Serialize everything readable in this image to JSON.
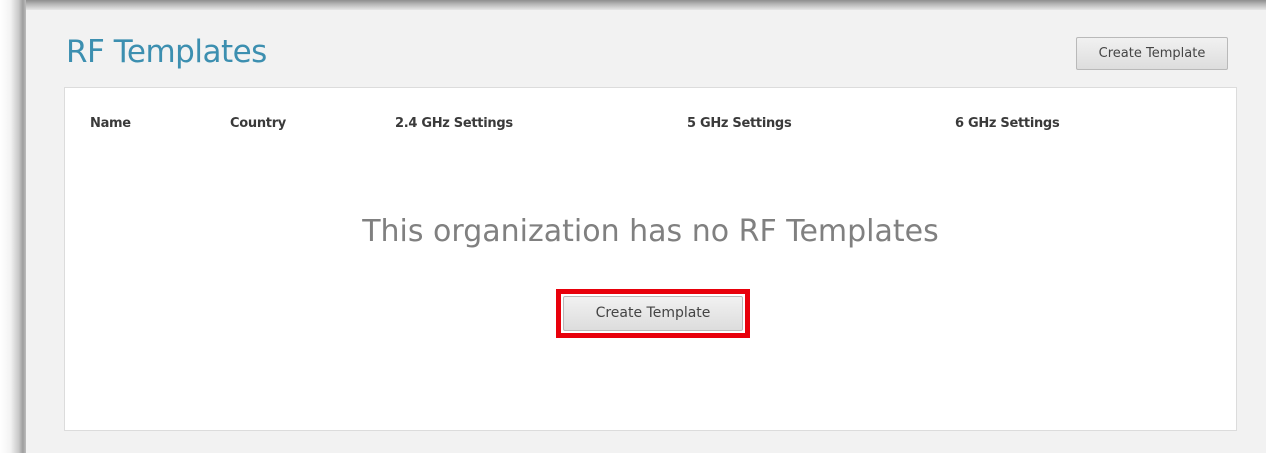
{
  "page": {
    "title": "RF Templates"
  },
  "toolbar": {
    "create_label": "Create Template"
  },
  "table": {
    "columns": [
      "Name",
      "Country",
      "2.4 GHz Settings",
      "5 GHz Settings",
      "6 GHz Settings"
    ]
  },
  "empty_state": {
    "message": "This organization has no RF Templates",
    "create_label": "Create Template",
    "highlight_color": "#e8000b"
  },
  "colors": {
    "title": "#3c8fb0",
    "background": "#f2f2f2",
    "panel": "#ffffff"
  }
}
